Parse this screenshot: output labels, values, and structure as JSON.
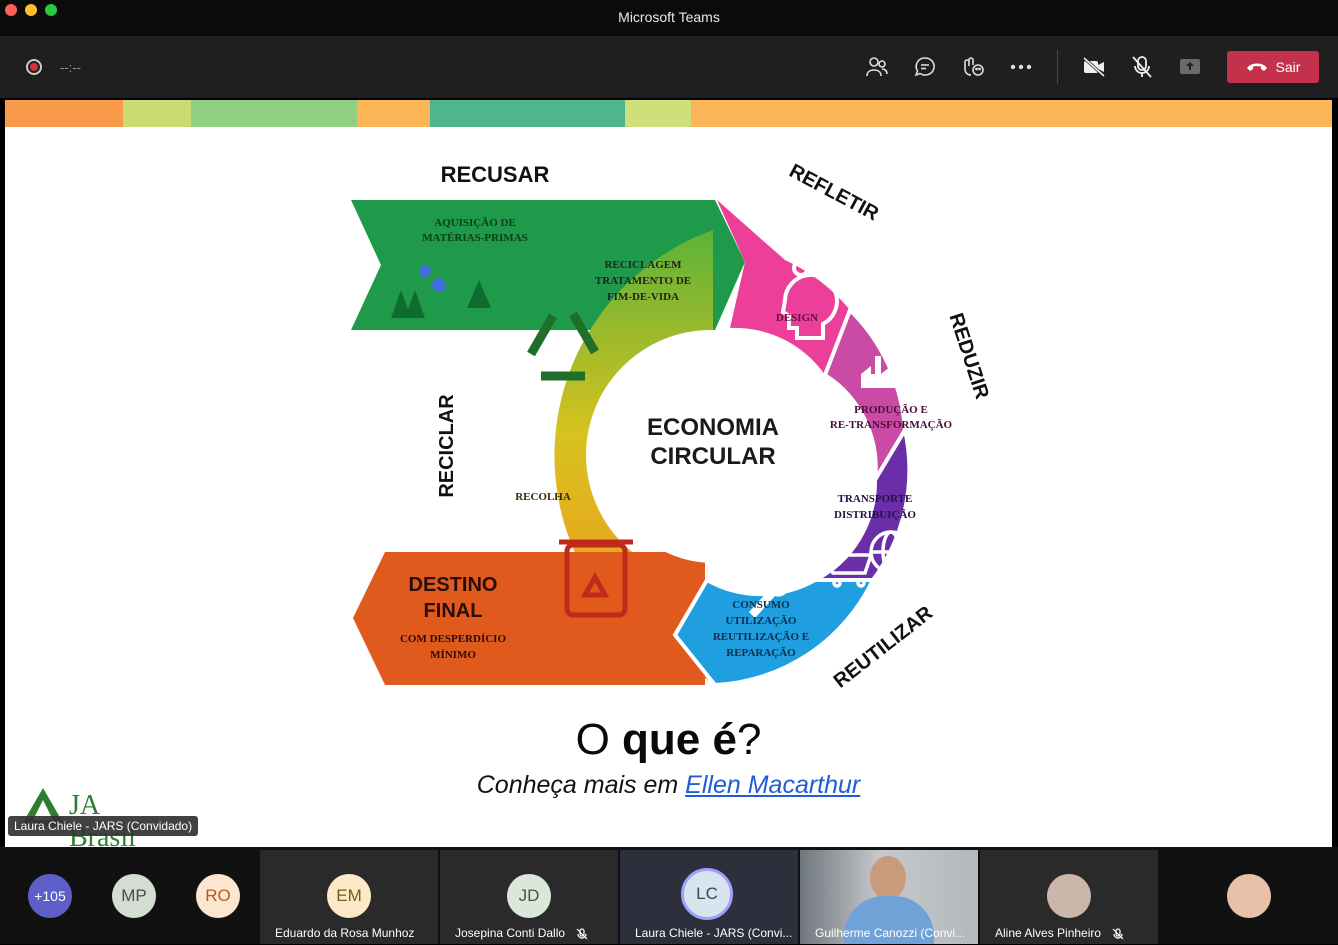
{
  "window": {
    "title": "Microsoft Teams"
  },
  "toolbar": {
    "timer": "--:--",
    "leave_label": "Sair",
    "icons": [
      "people-icon",
      "chat-icon",
      "reactions-icon",
      "more-icon",
      "camera-off-icon",
      "mic-off-icon",
      "share-icon"
    ]
  },
  "slide": {
    "arrows": {
      "recusar": "RECUSAR",
      "refletir": "REFLETIR",
      "reduzir": "REDUZIR",
      "reutilizar": "REUTILIZAR",
      "reciclar": "RECICLAR"
    },
    "center": {
      "line1": "ECONOMIA",
      "line2": "CIRCULAR"
    },
    "segments": {
      "aquisicao": [
        "AQUISIÇÃO DE",
        "MATÉRIAS-PRIMAS"
      ],
      "reciclagem": [
        "RECICLAGEM",
        "TRATAMENTO DE",
        "FIM-DE-VIDA"
      ],
      "design": "DESIGN",
      "producao": [
        "PRODUÇÃO E",
        "RE-TRANSFORMAÇÃO"
      ],
      "transporte": [
        "TRANSPORTE",
        "DISTRIBUIÇÃO"
      ],
      "consumo": [
        "CONSUMO",
        "UTILIZAÇÃO",
        "REUTILIZAÇÃO E",
        "REPARAÇÃO"
      ],
      "recolha": "RECOLHA",
      "destino": [
        "DESTINO",
        "FINAL"
      ],
      "desperdicio": [
        "COM DESPERDÍCIO",
        "MÍNIMO"
      ]
    },
    "question": {
      "prefix": "O",
      "bold": "que é",
      "suffix": "?"
    },
    "subtitle": {
      "text": "Conheça mais em ",
      "link": "Ellen Macarthur"
    },
    "logo_text": "JA Brasil",
    "speaker_label": "Laura Chiele - JARS (Convidado)"
  },
  "participants": {
    "overflow": "+105",
    "avatars": [
      {
        "initials": "MP",
        "bg": "#d3ddd2",
        "fg": "#4a4a4a"
      },
      {
        "initials": "RO",
        "bg": "#fde6cf",
        "fg": "#b9591b"
      }
    ],
    "tiles": [
      {
        "initials": "EM",
        "name": "Eduardo da Rosa Munhoz",
        "bg": "#fbe9c8",
        "fg": "#7a5a1a",
        "muted": false
      },
      {
        "initials": "JD",
        "name": "Josepina Conti Dallo",
        "bg": "#dbe7da",
        "fg": "#3c5a3c",
        "muted": true
      },
      {
        "initials": "LC",
        "name": "Laura Chiele - JARS (Convi...",
        "bg": "#d8e5ec",
        "fg": "#2d4b5b",
        "muted": false
      },
      {
        "initials": "",
        "name": "Guilherme Canozzi (Convi...",
        "bg": "#7f7f7f",
        "fg": "#fff",
        "muted": false
      },
      {
        "initials": "",
        "name": "Aline Alves Pinheiro",
        "bg": "#cbb7aa",
        "fg": "#fff",
        "muted": true
      }
    ]
  },
  "colors": {
    "leave": "#c4314b",
    "accent": "#6264a7"
  }
}
